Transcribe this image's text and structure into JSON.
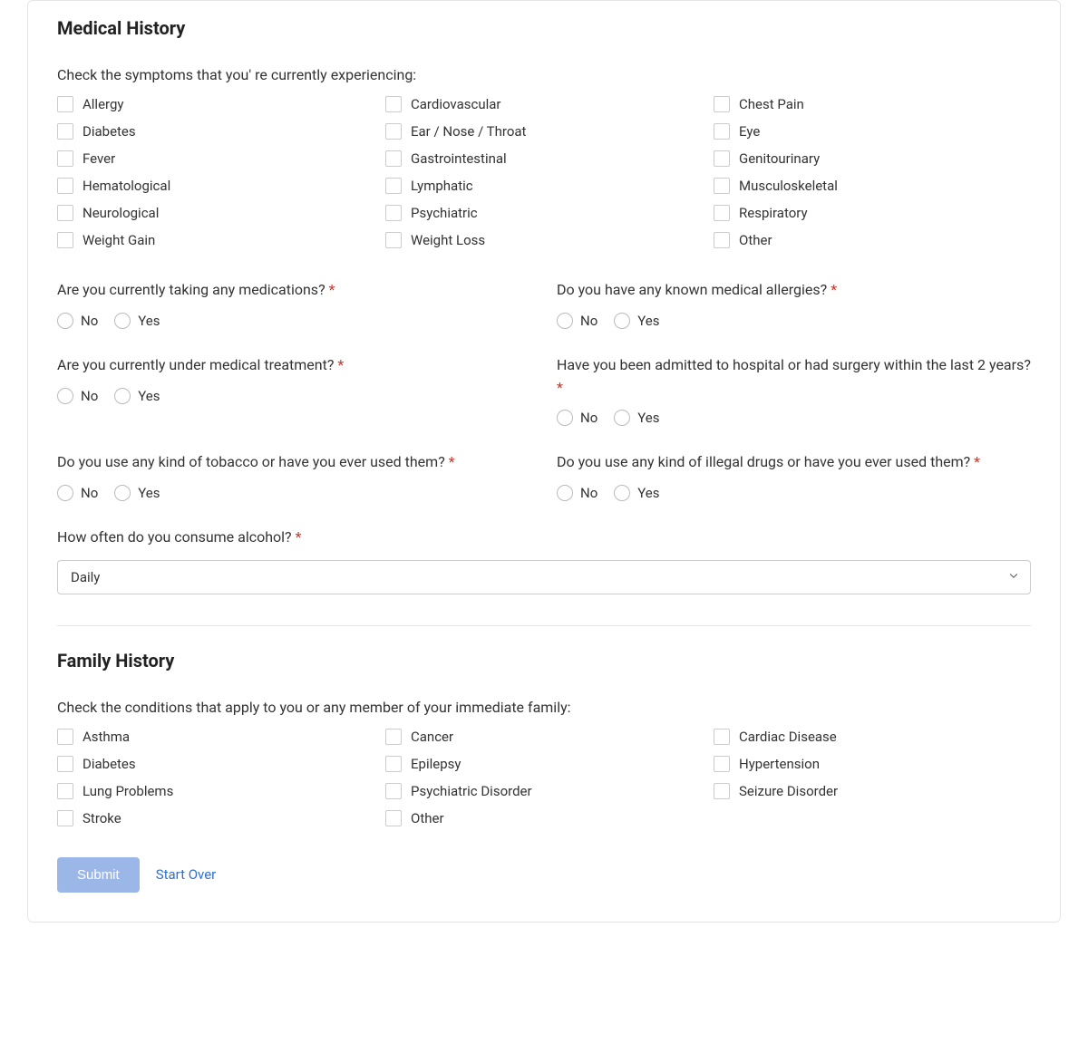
{
  "sections": {
    "medical": {
      "title": "Medical History",
      "symptoms_prompt": "Check the symptoms that you' re currently experiencing:",
      "symptoms": [
        "Allergy",
        "Cardiovascular",
        "Chest Pain",
        "Diabetes",
        "Ear / Nose / Throat",
        "Eye",
        "Fever",
        "Gastrointestinal",
        "Genitourinary",
        "Hematological",
        "Lymphatic",
        "Musculoskeletal",
        "Neurological",
        "Psychiatric",
        "Respiratory",
        "Weight Gain",
        "Weight Loss",
        "Other"
      ],
      "questions": [
        {
          "label": "Are you currently taking any medications?",
          "required": true
        },
        {
          "label": "Do you have any known medical allergies?",
          "required": true
        },
        {
          "label": "Are you currently under medical treatment?",
          "required": true
        },
        {
          "label": "Have you been admitted to hospital or had surgery within the last 2 years?",
          "required": true
        },
        {
          "label": "Do you use any kind of tobacco or have you ever used them?",
          "required": true
        },
        {
          "label": "Do you use any kind of illegal drugs or have you ever used them?",
          "required": true
        }
      ],
      "radio_options": {
        "no": "No",
        "yes": "Yes"
      },
      "alcohol_question": {
        "label": "How often do you consume alcohol?",
        "required": true,
        "selected": "Daily"
      }
    },
    "family": {
      "title": "Family History",
      "conditions_prompt": "Check the conditions that apply to you or any member of your immediate family:",
      "conditions": [
        "Asthma",
        "Cancer",
        "Cardiac Disease",
        "Diabetes",
        "Epilepsy",
        "Hypertension",
        "Lung Problems",
        "Psychiatric Disorder",
        "Seizure Disorder",
        "Stroke",
        "Other"
      ]
    }
  },
  "actions": {
    "submit": "Submit",
    "start_over": "Start Over"
  },
  "required_marker": "*"
}
